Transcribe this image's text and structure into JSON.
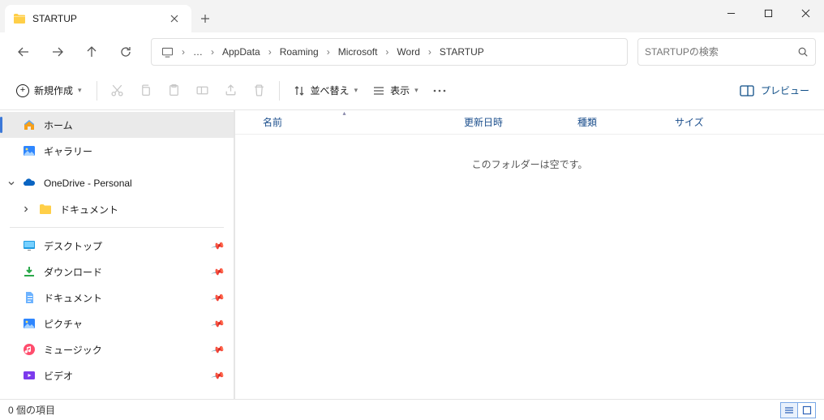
{
  "window": {
    "tab_title": "STARTUP"
  },
  "nav": {
    "breadcrumbs": [
      "AppData",
      "Roaming",
      "Microsoft",
      "Word",
      "STARTUP"
    ]
  },
  "search": {
    "placeholder": "STARTUPの検索"
  },
  "toolbar": {
    "new_label": "新規作成",
    "sort_label": "並べ替え",
    "view_label": "表示",
    "preview_label": "プレビュー"
  },
  "sidebar": {
    "home": "ホーム",
    "gallery": "ギャラリー",
    "onedrive": "OneDrive - Personal",
    "documents_od": "ドキュメント",
    "desktop": "デスクトップ",
    "downloads": "ダウンロード",
    "documents": "ドキュメント",
    "pictures": "ピクチャ",
    "music": "ミュージック",
    "videos": "ビデオ"
  },
  "columns": {
    "name": "名前",
    "date": "更新日時",
    "type": "種類",
    "size": "サイズ"
  },
  "content": {
    "empty_message": "このフォルダーは空です。"
  },
  "status": {
    "item_count": "0 個の項目"
  }
}
